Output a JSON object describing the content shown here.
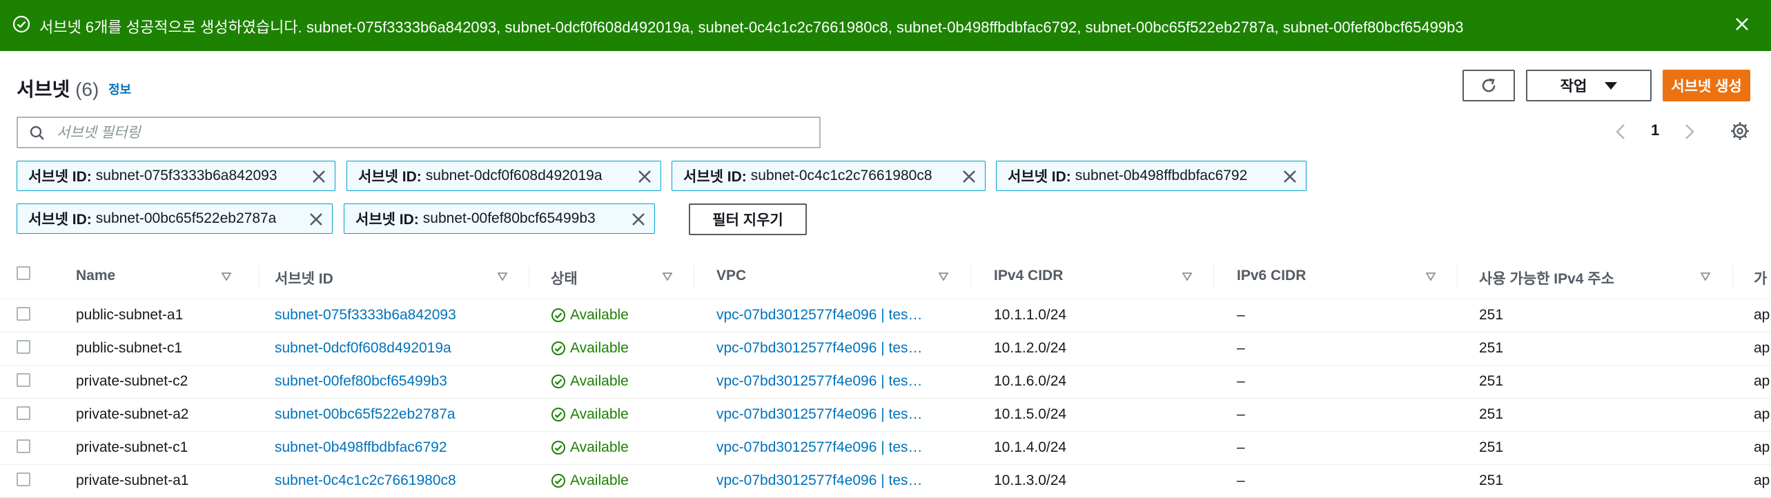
{
  "flash": {
    "message": "서브넷 6개를 성공적으로 생성하였습니다. subnet-075f3333b6a842093, subnet-0dcf0f608d492019a, subnet-0c4c1c2c7661980c8, subnet-0b498ffbdbfac6792, subnet-00bc65f522eb2787a, subnet-00fef80bcf65499b3",
    "icon": "check-circle-icon",
    "color": "#1d8102"
  },
  "header": {
    "title": "서브넷",
    "count": "(6)",
    "info_link": "정보"
  },
  "toolbar": {
    "refresh_icon": "refresh-icon",
    "actions_label": "작업",
    "create_label": "서브넷 생성",
    "create_color": "#ec7211"
  },
  "search": {
    "placeholder": "서브넷 필터링",
    "value": ""
  },
  "pagination": {
    "current_page": "1"
  },
  "filters": {
    "tokens": [
      {
        "label": "서브넷 ID:",
        "value": "subnet-075f3333b6a842093"
      },
      {
        "label": "서브넷 ID:",
        "value": "subnet-0dcf0f608d492019a"
      },
      {
        "label": "서브넷 ID:",
        "value": "subnet-0c4c1c2c7661980c8"
      },
      {
        "label": "서브넷 ID:",
        "value": "subnet-0b498ffbdbfac6792"
      },
      {
        "label": "서브넷 ID:",
        "value": "subnet-00bc65f522eb2787a"
      },
      {
        "label": "서브넷 ID:",
        "value": "subnet-00fef80bcf65499b3"
      }
    ],
    "clear_label": "필터 지우기"
  },
  "table": {
    "columns": [
      "Name",
      "서브넷 ID",
      "상태",
      "VPC",
      "IPv4 CIDR",
      "IPv6 CIDR",
      "사용 가능한 IPv4 주소",
      "가"
    ],
    "rows": [
      {
        "name": "public-subnet-a1",
        "subnet_id": "subnet-075f3333b6a842093",
        "status": "Available",
        "vpc": "vpc-07bd3012577f4e096 | tes…",
        "ipv4": "10.1.1.0/24",
        "ipv6": "–",
        "available_ips": "251",
        "az": "ap"
      },
      {
        "name": "public-subnet-c1",
        "subnet_id": "subnet-0dcf0f608d492019a",
        "status": "Available",
        "vpc": "vpc-07bd3012577f4e096 | tes…",
        "ipv4": "10.1.2.0/24",
        "ipv6": "–",
        "available_ips": "251",
        "az": "ap"
      },
      {
        "name": "private-subnet-c2",
        "subnet_id": "subnet-00fef80bcf65499b3",
        "status": "Available",
        "vpc": "vpc-07bd3012577f4e096 | tes…",
        "ipv4": "10.1.6.0/24",
        "ipv6": "–",
        "available_ips": "251",
        "az": "ap"
      },
      {
        "name": "private-subnet-a2",
        "subnet_id": "subnet-00bc65f522eb2787a",
        "status": "Available",
        "vpc": "vpc-07bd3012577f4e096 | tes…",
        "ipv4": "10.1.5.0/24",
        "ipv6": "–",
        "available_ips": "251",
        "az": "ap"
      },
      {
        "name": "private-subnet-c1",
        "subnet_id": "subnet-0b498ffbdbfac6792",
        "status": "Available",
        "vpc": "vpc-07bd3012577f4e096 | tes…",
        "ipv4": "10.1.4.0/24",
        "ipv6": "–",
        "available_ips": "251",
        "az": "ap"
      },
      {
        "name": "private-subnet-a1",
        "subnet_id": "subnet-0c4c1c2c7661980c8",
        "status": "Available",
        "vpc": "vpc-07bd3012577f4e096 | tes…",
        "ipv4": "10.1.3.0/24",
        "ipv6": "–",
        "available_ips": "251",
        "az": "ap"
      }
    ]
  }
}
